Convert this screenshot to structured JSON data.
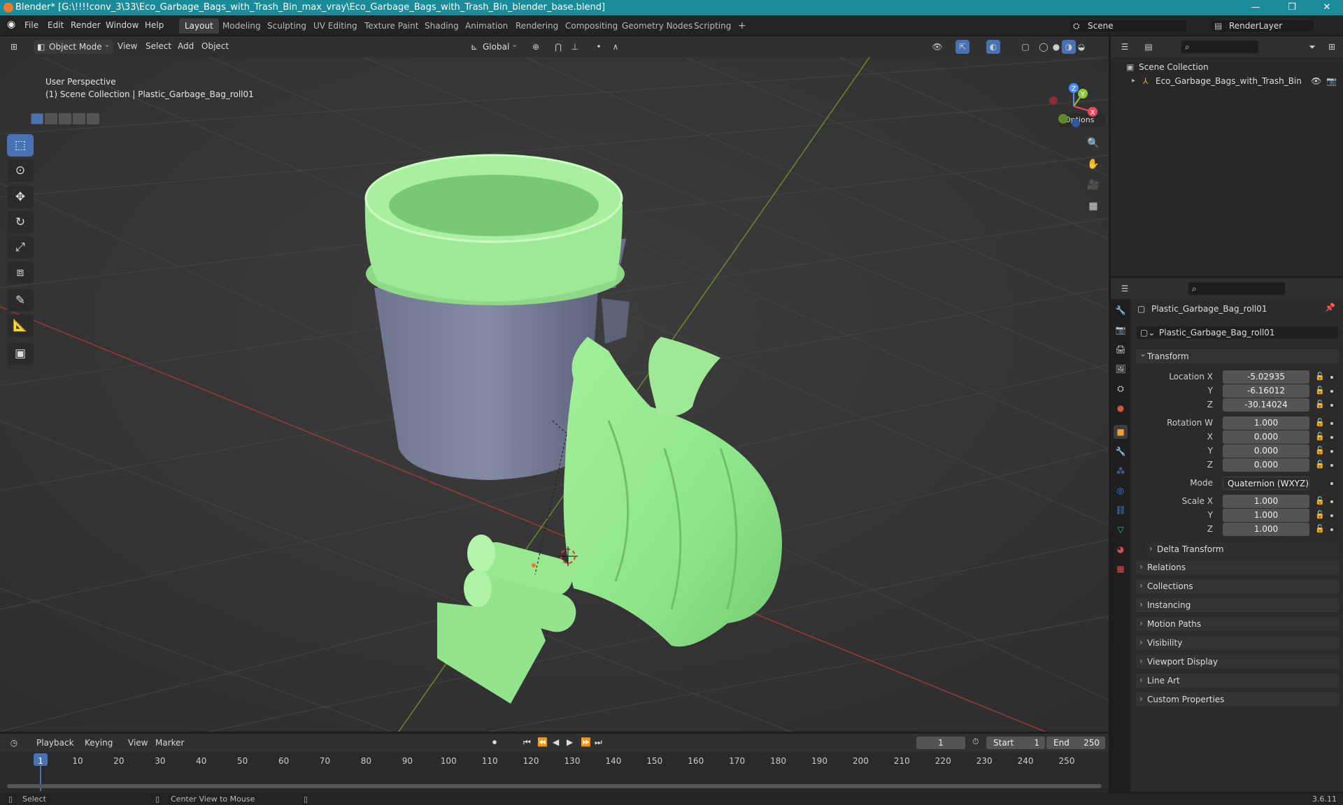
{
  "window": {
    "title": "Blender* [G:\\!!!!conv_3\\33\\Eco_Garbage_Bags_with_Trash_Bin_max_vray\\Eco_Garbage_Bags_with_Trash_Bin_blender_base.blend]",
    "minimize": "—",
    "maximize": "❐",
    "close": "✕"
  },
  "menu": {
    "items": [
      "File",
      "Edit",
      "Render",
      "Window",
      "Help"
    ],
    "workspaces": [
      "Layout",
      "Modeling",
      "Sculpting",
      "UV Editing",
      "Texture Paint",
      "Shading",
      "Animation",
      "Rendering",
      "Compositing",
      "Geometry Nodes",
      "Scripting"
    ],
    "add_tab": "+",
    "scene": "Scene",
    "render_layer": "RenderLayer"
  },
  "viewport_header": {
    "mode": "Object Mode",
    "menus": [
      "View",
      "Select",
      "Add",
      "Object"
    ],
    "orientation": "Global",
    "options": "Options"
  },
  "viewport": {
    "perspective": "User Perspective",
    "context": "(1) Scene Collection | Plastic_Garbage_Bag_roll01",
    "gizmo": {
      "x": "X",
      "y": "Y",
      "z": "Z"
    }
  },
  "outliner": {
    "collection": "Scene Collection",
    "items": [
      {
        "name": "Eco_Garbage_Bags_with_Trash_Bin"
      }
    ]
  },
  "properties": {
    "object_name": "Plastic_Garbage_Bag_roll01",
    "data_name": "Plastic_Garbage_Bag_roll01",
    "transform_label": "Transform",
    "location": {
      "label": "Location X",
      "x": "-5.02935",
      "y": "-6.16012",
      "z": "-30.14024"
    },
    "rotation": {
      "label": "Rotation W",
      "w": "1.000",
      "x": "0.000",
      "y": "0.000",
      "z": "0.000"
    },
    "mode": {
      "label": "Mode",
      "value": "Quaternion (WXYZ)"
    },
    "scale": {
      "label": "Scale X",
      "x": "1.000",
      "y": "1.000",
      "z": "1.000"
    },
    "axis_labels": {
      "x": "X",
      "y": "Y",
      "z": "Z"
    },
    "delta": "Delta Transform",
    "panels": [
      "Relations",
      "Collections",
      "Instancing",
      "Motion Paths",
      "Visibility",
      "Viewport Display",
      "Line Art",
      "Custom Properties"
    ]
  },
  "timeline": {
    "menus": [
      "Playback",
      "Keying",
      "View",
      "Marker"
    ],
    "current_frame": "1",
    "start_label": "Start",
    "start": "1",
    "end_label": "End",
    "end": "250",
    "ticks": [
      "1",
      "10",
      "20",
      "30",
      "40",
      "50",
      "60",
      "70",
      "80",
      "90",
      "100",
      "110",
      "120",
      "130",
      "140",
      "150",
      "160",
      "170",
      "180",
      "190",
      "200",
      "210",
      "220",
      "230",
      "240",
      "250"
    ]
  },
  "status": {
    "select": "Select",
    "center": "Center View to Mouse",
    "version": "3.6.11"
  }
}
